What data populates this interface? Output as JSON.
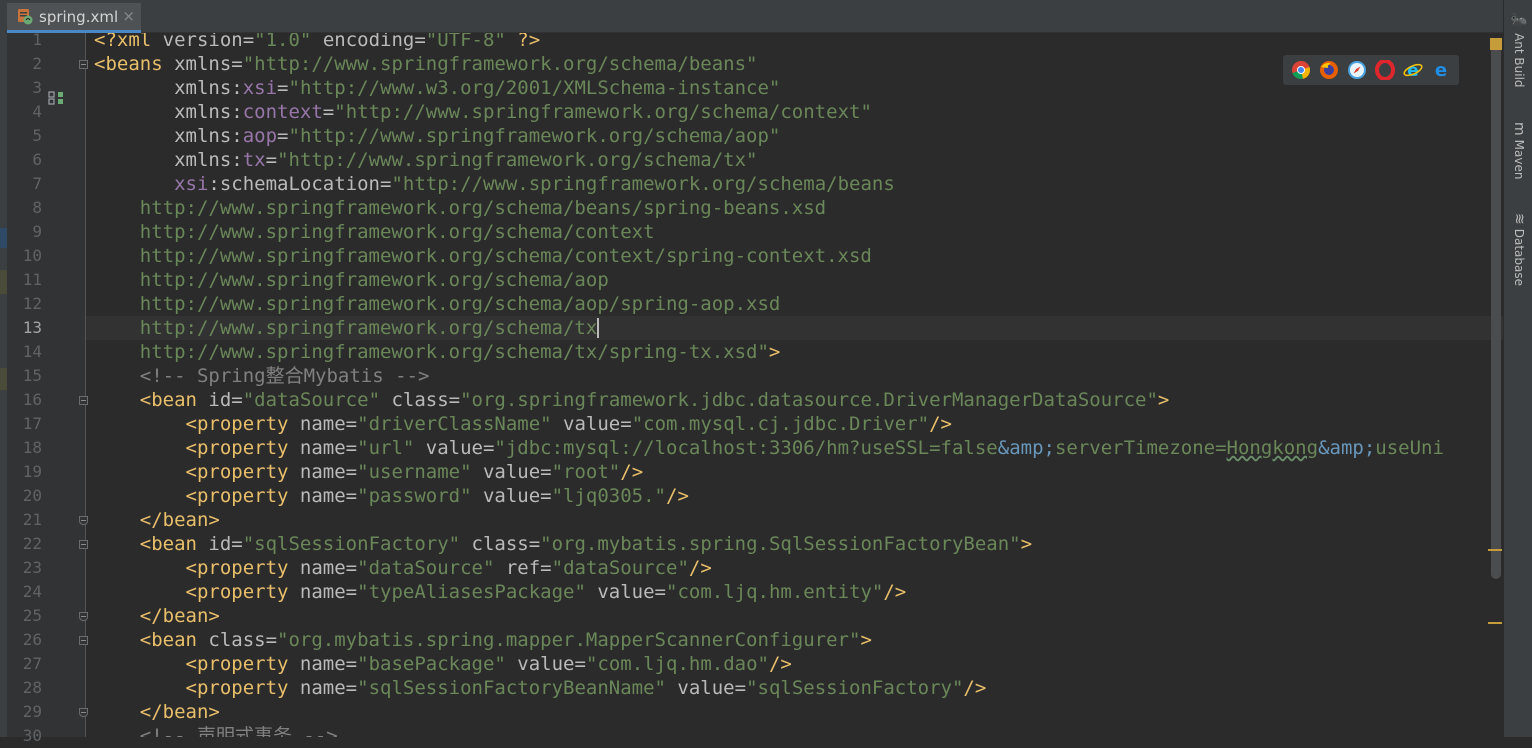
{
  "tab": {
    "filename": "spring.xml",
    "close_icon": "×"
  },
  "colors": {
    "tag": "#e8bf6a",
    "attr": "#bababa",
    "value": "#6a8759",
    "namespace": "#9876aa",
    "comment": "#808080",
    "entity": "#6897bb"
  },
  "editor": {
    "current_line": 13,
    "line_numbers": [
      "1",
      "2",
      "3",
      "4",
      "5",
      "6",
      "7",
      "8",
      "9",
      "10",
      "11",
      "12",
      "13",
      "14",
      "15",
      "16",
      "17",
      "18",
      "19",
      "20",
      "21",
      "22",
      "23",
      "24",
      "25",
      "26",
      "27",
      "28",
      "29",
      "30"
    ],
    "lines": [
      [
        {
          "t": "<?xml ",
          "c": "t"
        },
        {
          "t": "version",
          "c": "a"
        },
        {
          "t": "=",
          "c": "a"
        },
        {
          "t": "\"1.0\"",
          "c": "v"
        },
        {
          "t": " encoding",
          "c": "a"
        },
        {
          "t": "=",
          "c": "a"
        },
        {
          "t": "\"UTF-8\"",
          "c": "v"
        },
        {
          "t": " ?>",
          "c": "t"
        }
      ],
      [
        {
          "t": "<beans ",
          "c": "t"
        },
        {
          "t": "xmlns",
          "c": "a"
        },
        {
          "t": "=",
          "c": "a"
        },
        {
          "t": "\"http://www.springframework.org/schema/beans\"",
          "c": "v"
        }
      ],
      [
        {
          "t": "       xmlns:",
          "c": "a"
        },
        {
          "t": "xsi",
          "c": "ns"
        },
        {
          "t": "=",
          "c": "a"
        },
        {
          "t": "\"http://www.w3.org/2001/XMLSchema-instance\"",
          "c": "v"
        }
      ],
      [
        {
          "t": "       xmlns:",
          "c": "a"
        },
        {
          "t": "context",
          "c": "ns"
        },
        {
          "t": "=",
          "c": "a"
        },
        {
          "t": "\"http://www.springframework.org/schema/context\"",
          "c": "v"
        }
      ],
      [
        {
          "t": "       xmlns:",
          "c": "a"
        },
        {
          "t": "aop",
          "c": "ns"
        },
        {
          "t": "=",
          "c": "a"
        },
        {
          "t": "\"http://www.springframework.org/schema/aop\"",
          "c": "v"
        }
      ],
      [
        {
          "t": "       xmlns:",
          "c": "a"
        },
        {
          "t": "tx",
          "c": "ns"
        },
        {
          "t": "=",
          "c": "a"
        },
        {
          "t": "\"http://www.springframework.org/schema/tx\"",
          "c": "v"
        }
      ],
      [
        {
          "t": "       ",
          "c": "a"
        },
        {
          "t": "xsi",
          "c": "ns"
        },
        {
          "t": ":schemaLocation",
          "c": "a"
        },
        {
          "t": "=",
          "c": "a"
        },
        {
          "t": "\"http://www.springframework.org/schema/beans",
          "c": "v"
        }
      ],
      [
        {
          "t": "    http://www.springframework.org/schema/beans/spring-beans.xsd",
          "c": "v"
        }
      ],
      [
        {
          "t": "    http://www.springframework.org/schema/context",
          "c": "v"
        }
      ],
      [
        {
          "t": "    http://www.springframework.org/schema/context/spring-context.xsd",
          "c": "v"
        }
      ],
      [
        {
          "t": "    http://www.springframework.org/schema/aop",
          "c": "v"
        }
      ],
      [
        {
          "t": "    http://www.springframework.org/schema/aop/spring-aop.xsd",
          "c": "v"
        }
      ],
      [
        {
          "t": "    http://www.springframework.org/schema/tx",
          "c": "v"
        },
        {
          "t": "",
          "c": "caret"
        }
      ],
      [
        {
          "t": "    http://www.springframework.org/schema/tx/spring-tx.xsd\"",
          "c": "v"
        },
        {
          "t": ">",
          "c": "t"
        }
      ],
      [
        {
          "t": "    <!-- Spring整合Mybatis -->",
          "c": "c"
        }
      ],
      [
        {
          "t": "    <bean ",
          "c": "t"
        },
        {
          "t": "id",
          "c": "a"
        },
        {
          "t": "=",
          "c": "a"
        },
        {
          "t": "\"dataSource\"",
          "c": "v"
        },
        {
          "t": " class",
          "c": "a"
        },
        {
          "t": "=",
          "c": "a"
        },
        {
          "t": "\"org.springframework.jdbc.datasource.DriverManagerDataSource\"",
          "c": "v"
        },
        {
          "t": ">",
          "c": "t"
        }
      ],
      [
        {
          "t": "        <property ",
          "c": "t"
        },
        {
          "t": "name",
          "c": "a"
        },
        {
          "t": "=",
          "c": "a"
        },
        {
          "t": "\"driverClassName\"",
          "c": "v"
        },
        {
          "t": " value",
          "c": "a"
        },
        {
          "t": "=",
          "c": "a"
        },
        {
          "t": "\"com.mysql.cj.jdbc.Driver\"",
          "c": "v"
        },
        {
          "t": "/>",
          "c": "t"
        }
      ],
      [
        {
          "t": "        <property ",
          "c": "t"
        },
        {
          "t": "name",
          "c": "a"
        },
        {
          "t": "=",
          "c": "a"
        },
        {
          "t": "\"url\"",
          "c": "v"
        },
        {
          "t": " value",
          "c": "a"
        },
        {
          "t": "=",
          "c": "a"
        },
        {
          "t": "\"jdbc:mysql://localhost:3306/hm?useSSL=false",
          "c": "v"
        },
        {
          "t": "&amp;",
          "c": "e"
        },
        {
          "t": "serverTimezone=",
          "c": "v"
        },
        {
          "t": "Hongkong",
          "c": "vu"
        },
        {
          "t": "&amp;",
          "c": "e"
        },
        {
          "t": "useUni",
          "c": "v"
        }
      ],
      [
        {
          "t": "        <property ",
          "c": "t"
        },
        {
          "t": "name",
          "c": "a"
        },
        {
          "t": "=",
          "c": "a"
        },
        {
          "t": "\"username\"",
          "c": "v"
        },
        {
          "t": " value",
          "c": "a"
        },
        {
          "t": "=",
          "c": "a"
        },
        {
          "t": "\"root\"",
          "c": "v"
        },
        {
          "t": "/>",
          "c": "t"
        }
      ],
      [
        {
          "t": "        <property ",
          "c": "t"
        },
        {
          "t": "name",
          "c": "a"
        },
        {
          "t": "=",
          "c": "a"
        },
        {
          "t": "\"password\"",
          "c": "v"
        },
        {
          "t": " value",
          "c": "a"
        },
        {
          "t": "=",
          "c": "a"
        },
        {
          "t": "\"ljq0305.\"",
          "c": "v"
        },
        {
          "t": "/>",
          "c": "t"
        }
      ],
      [
        {
          "t": "    </bean>",
          "c": "t"
        }
      ],
      [
        {
          "t": "    <bean ",
          "c": "t"
        },
        {
          "t": "id",
          "c": "a"
        },
        {
          "t": "=",
          "c": "a"
        },
        {
          "t": "\"sqlSessionFactory\"",
          "c": "v"
        },
        {
          "t": " class",
          "c": "a"
        },
        {
          "t": "=",
          "c": "a"
        },
        {
          "t": "\"org.mybatis.spring.SqlSessionFactoryBean\"",
          "c": "v"
        },
        {
          "t": ">",
          "c": "t"
        }
      ],
      [
        {
          "t": "        <property ",
          "c": "t"
        },
        {
          "t": "name",
          "c": "a"
        },
        {
          "t": "=",
          "c": "a"
        },
        {
          "t": "\"dataSource\"",
          "c": "v"
        },
        {
          "t": " ref",
          "c": "a"
        },
        {
          "t": "=",
          "c": "a"
        },
        {
          "t": "\"dataSource\"",
          "c": "v"
        },
        {
          "t": "/>",
          "c": "t"
        }
      ],
      [
        {
          "t": "        <property ",
          "c": "t"
        },
        {
          "t": "name",
          "c": "a"
        },
        {
          "t": "=",
          "c": "a"
        },
        {
          "t": "\"typeAliasesPackage\"",
          "c": "v"
        },
        {
          "t": " value",
          "c": "a"
        },
        {
          "t": "=",
          "c": "a"
        },
        {
          "t": "\"com.ljq.hm.entity\"",
          "c": "v"
        },
        {
          "t": "/>",
          "c": "t"
        }
      ],
      [
        {
          "t": "    </bean>",
          "c": "t"
        }
      ],
      [
        {
          "t": "    <bean ",
          "c": "t"
        },
        {
          "t": "class",
          "c": "a"
        },
        {
          "t": "=",
          "c": "a"
        },
        {
          "t": "\"org.mybatis.spring.mapper.MapperScannerConfigurer\"",
          "c": "v"
        },
        {
          "t": ">",
          "c": "t"
        }
      ],
      [
        {
          "t": "        <property ",
          "c": "t"
        },
        {
          "t": "name",
          "c": "a"
        },
        {
          "t": "=",
          "c": "a"
        },
        {
          "t": "\"basePackage\"",
          "c": "v"
        },
        {
          "t": " value",
          "c": "a"
        },
        {
          "t": "=",
          "c": "a"
        },
        {
          "t": "\"com.ljq.hm.dao\"",
          "c": "v"
        },
        {
          "t": "/>",
          "c": "t"
        }
      ],
      [
        {
          "t": "        <property ",
          "c": "t"
        },
        {
          "t": "name",
          "c": "a"
        },
        {
          "t": "=",
          "c": "a"
        },
        {
          "t": "\"sqlSessionFactoryBeanName\"",
          "c": "v"
        },
        {
          "t": " value",
          "c": "a"
        },
        {
          "t": "=",
          "c": "a"
        },
        {
          "t": "\"sqlSessionFactory\"",
          "c": "v"
        },
        {
          "t": "/>",
          "c": "t"
        }
      ],
      [
        {
          "t": "    </bean>",
          "c": "t"
        }
      ],
      [
        {
          "t": "    <!-- 声明式事务 -->",
          "c": "c"
        }
      ]
    ],
    "fold_markers": [
      {
        "line": 2,
        "kind": "open"
      },
      {
        "line": 16,
        "kind": "open"
      },
      {
        "line": 21,
        "kind": "end"
      },
      {
        "line": 22,
        "kind": "open"
      },
      {
        "line": 25,
        "kind": "end"
      },
      {
        "line": 26,
        "kind": "open"
      },
      {
        "line": 29,
        "kind": "end"
      }
    ]
  },
  "browsers": [
    {
      "name": "chrome-icon"
    },
    {
      "name": "firefox-icon"
    },
    {
      "name": "safari-icon"
    },
    {
      "name": "opera-icon"
    },
    {
      "name": "ie-icon"
    },
    {
      "name": "edge-icon"
    }
  ],
  "right_tools": [
    {
      "label": "Ant Build",
      "icon": "ant-icon",
      "glyph": "🐜"
    },
    {
      "label": "Maven",
      "icon": "maven-icon",
      "glyph": "m"
    },
    {
      "label": "Database",
      "icon": "database-icon",
      "glyph": "≋"
    }
  ]
}
